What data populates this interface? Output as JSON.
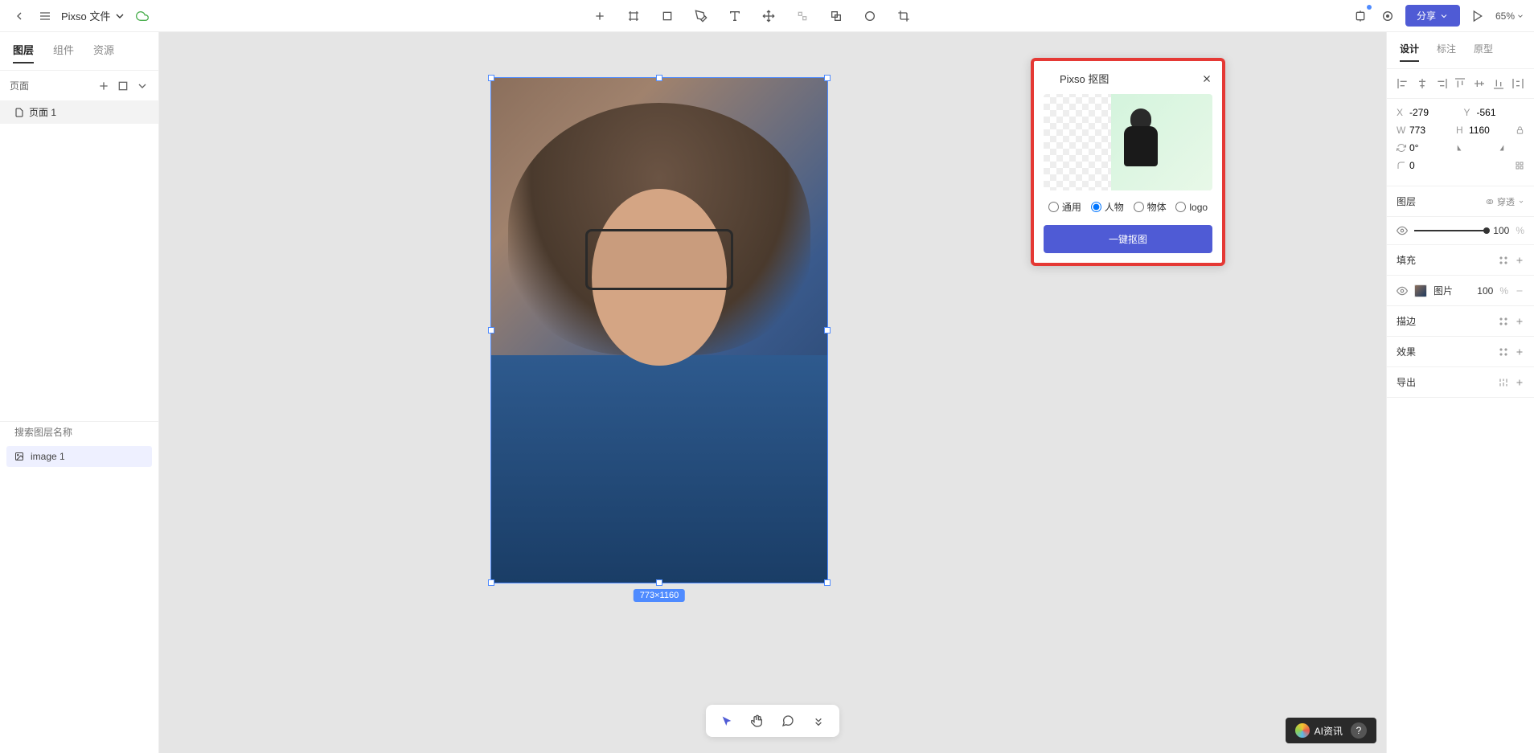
{
  "topbar": {
    "file_name": "Pixso 文件",
    "share_label": "分享",
    "zoom": "65%"
  },
  "left_panel": {
    "tabs": [
      "图层",
      "组件",
      "资源"
    ],
    "pages_label": "页面",
    "pages": [
      "页面 1"
    ],
    "search_placeholder": "搜索图层名称",
    "layers": [
      "image 1"
    ]
  },
  "canvas": {
    "dimensions": "773×1160"
  },
  "plugin": {
    "title": "Pixso 抠图",
    "radios": [
      "通用",
      "人物",
      "物体",
      "logo"
    ],
    "selected_radio": "人物",
    "button": "一键抠图"
  },
  "right_panel": {
    "tabs": [
      "设计",
      "标注",
      "原型"
    ],
    "position": {
      "x_label": "X",
      "x": "-279",
      "y_label": "Y",
      "y": "-561"
    },
    "size": {
      "w_label": "W",
      "w": "773",
      "h_label": "H",
      "h": "1160"
    },
    "rotation": {
      "label": "",
      "value": "0°"
    },
    "radius": {
      "value": "0"
    },
    "layer_section": "图层",
    "pass_through": "穿透",
    "opacity": "100",
    "opacity_unit": "%",
    "fill_section": "填充",
    "fill_type": "图片",
    "fill_opacity": "100",
    "fill_unit": "%",
    "stroke_section": "描边",
    "effect_section": "效果",
    "export_section": "导出"
  },
  "watermark": {
    "text": "AI资讯",
    "help": "?"
  }
}
